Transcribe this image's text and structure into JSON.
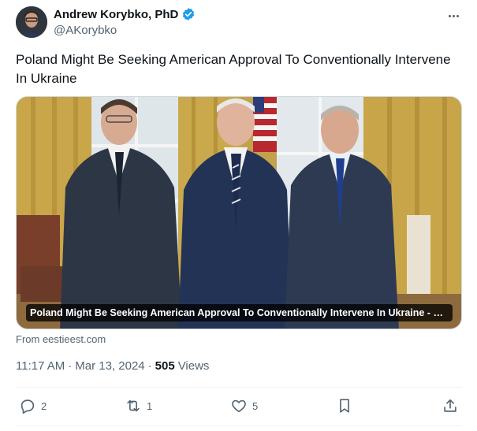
{
  "author": {
    "display_name": "Andrew Korybko, PhD",
    "handle": "@AKorybko",
    "verified": true
  },
  "post": {
    "text": "Poland Might Be Seeking American Approval To Conventionally Intervene In Ukraine",
    "card_caption": "Poland Might Be Seeking American Approval To Conventionally Intervene In Ukraine - Ee...",
    "card_source": "From eestieest.com",
    "time": "11:17 AM",
    "date": "Mar 13, 2024",
    "separator": "·",
    "views_count": "505",
    "views_label": "Views"
  },
  "actions": {
    "replies": "2",
    "reposts": "1",
    "likes": "5"
  },
  "icons": {
    "verified": "verified-badge-icon",
    "more": "more-dots-icon",
    "reply": "reply-bubble-icon",
    "repost": "repost-arrows-icon",
    "like": "heart-icon",
    "bookmark": "bookmark-icon",
    "share": "share-upload-icon"
  },
  "colors": {
    "verified_blue": "#1d9bf0",
    "secondary_text": "#536471",
    "primary_text": "#0f1419"
  }
}
